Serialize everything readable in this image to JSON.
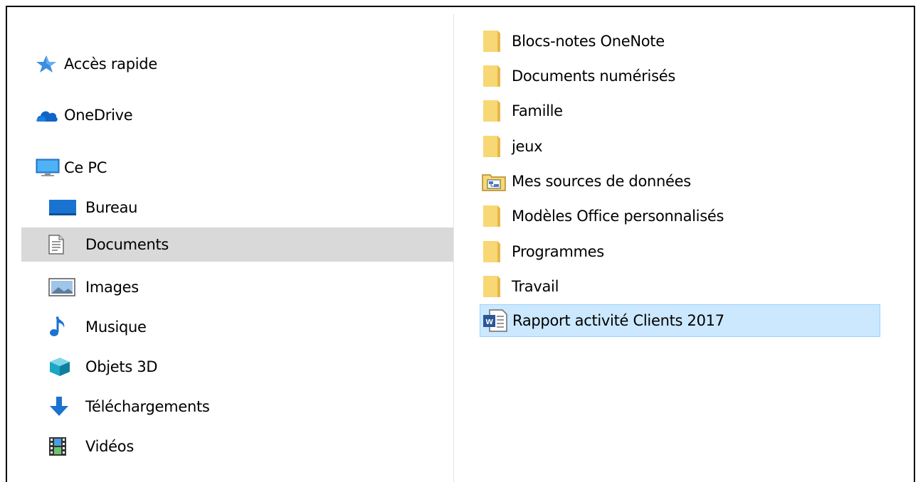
{
  "nav": {
    "items": [
      {
        "label": "Accès rapide",
        "icon": "star-icon"
      },
      {
        "label": "OneDrive",
        "icon": "cloud-icon"
      },
      {
        "label": "Ce PC",
        "icon": "computer-icon"
      },
      {
        "label": "Bureau",
        "icon": "desktop-icon"
      },
      {
        "label": "Documents",
        "icon": "documents-icon",
        "selected": true
      },
      {
        "label": "Images",
        "icon": "pictures-icon"
      },
      {
        "label": "Musique",
        "icon": "music-icon"
      },
      {
        "label": "Objets 3D",
        "icon": "3d-objects-icon"
      },
      {
        "label": "Téléchargements",
        "icon": "download-icon"
      },
      {
        "label": "Vidéos",
        "icon": "video-icon"
      }
    ]
  },
  "files": {
    "items": [
      {
        "name": "Blocs-notes OneNote",
        "type": "folder"
      },
      {
        "name": "Documents numérisés",
        "type": "folder"
      },
      {
        "name": "Famille",
        "type": "folder"
      },
      {
        "name": "jeux",
        "type": "folder"
      },
      {
        "name": "Mes sources de données",
        "type": "data-sources-folder"
      },
      {
        "name": "Modèles Office personnalisés",
        "type": "folder"
      },
      {
        "name": "Programmes",
        "type": "folder"
      },
      {
        "name": "Travail",
        "type": "folder"
      },
      {
        "name": "Rapport activité Clients 2017",
        "type": "word-document",
        "selected": true
      }
    ]
  },
  "colors": {
    "folder": "#f8d775",
    "folder_dark": "#e8b84a",
    "selection": "#cce8ff",
    "nav_selection": "#d9d9d9",
    "accent_blue": "#1e6fd9"
  }
}
